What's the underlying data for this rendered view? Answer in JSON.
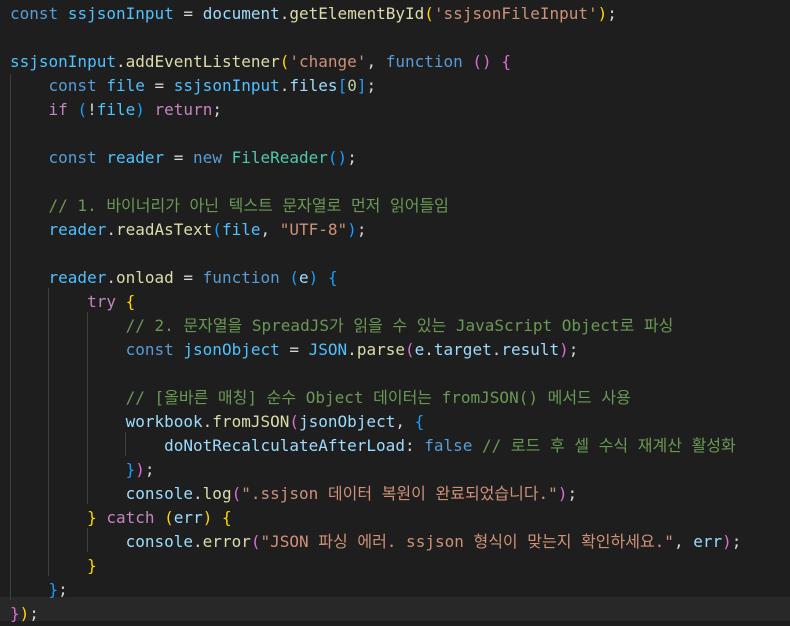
{
  "editor": {
    "lines": [
      [
        [
          "kw",
          "const"
        ],
        [
          "pl",
          " "
        ],
        [
          "cst",
          "ssjsonInput"
        ],
        [
          "pl",
          " = "
        ],
        [
          "var",
          "document"
        ],
        [
          "pl",
          "."
        ],
        [
          "fn",
          "getElementById"
        ],
        [
          "b1",
          "("
        ],
        [
          "str",
          "'ssjsonFileInput'"
        ],
        [
          "b1",
          ")"
        ],
        [
          "pl",
          ";"
        ]
      ],
      [],
      [
        [
          "cst",
          "ssjsonInput"
        ],
        [
          "pl",
          "."
        ],
        [
          "fn",
          "addEventListener"
        ],
        [
          "b1",
          "("
        ],
        [
          "str",
          "'change'"
        ],
        [
          "pl",
          ", "
        ],
        [
          "kw",
          "function"
        ],
        [
          "pl",
          " "
        ],
        [
          "b2",
          "()"
        ],
        [
          "pl",
          " "
        ],
        [
          "b2",
          "{"
        ]
      ],
      [
        [
          "pl",
          "    "
        ],
        [
          "kw",
          "const"
        ],
        [
          "pl",
          " "
        ],
        [
          "cst",
          "file"
        ],
        [
          "pl",
          " = "
        ],
        [
          "cst",
          "ssjsonInput"
        ],
        [
          "pl",
          "."
        ],
        [
          "var",
          "files"
        ],
        [
          "b3",
          "["
        ],
        [
          "num",
          "0"
        ],
        [
          "b3",
          "]"
        ],
        [
          "pl",
          ";"
        ]
      ],
      [
        [
          "pl",
          "    "
        ],
        [
          "ctl",
          "if"
        ],
        [
          "pl",
          " "
        ],
        [
          "b3",
          "("
        ],
        [
          "pl",
          "!"
        ],
        [
          "cst",
          "file"
        ],
        [
          "b3",
          ")"
        ],
        [
          "pl",
          " "
        ],
        [
          "ctl",
          "return"
        ],
        [
          "pl",
          ";"
        ]
      ],
      [],
      [
        [
          "pl",
          "    "
        ],
        [
          "kw",
          "const"
        ],
        [
          "pl",
          " "
        ],
        [
          "cst",
          "reader"
        ],
        [
          "pl",
          " = "
        ],
        [
          "kw",
          "new"
        ],
        [
          "pl",
          " "
        ],
        [
          "cls",
          "FileReader"
        ],
        [
          "b3",
          "()"
        ],
        [
          "pl",
          ";"
        ]
      ],
      [],
      [
        [
          "pl",
          "    "
        ],
        [
          "cmt",
          "// 1. 바이너리가 아닌 텍스트 문자열로 먼저 읽어들임"
        ]
      ],
      [
        [
          "pl",
          "    "
        ],
        [
          "cst",
          "reader"
        ],
        [
          "pl",
          "."
        ],
        [
          "fn",
          "readAsText"
        ],
        [
          "b3",
          "("
        ],
        [
          "cst",
          "file"
        ],
        [
          "pl",
          ", "
        ],
        [
          "str",
          "\"UTF-8\""
        ],
        [
          "b3",
          ")"
        ],
        [
          "pl",
          ";"
        ]
      ],
      [],
      [
        [
          "pl",
          "    "
        ],
        [
          "cst",
          "reader"
        ],
        [
          "pl",
          "."
        ],
        [
          "fn",
          "onload"
        ],
        [
          "pl",
          " = "
        ],
        [
          "kw",
          "function"
        ],
        [
          "pl",
          " "
        ],
        [
          "b3",
          "("
        ],
        [
          "var",
          "e"
        ],
        [
          "b3",
          ")"
        ],
        [
          "pl",
          " "
        ],
        [
          "b3",
          "{"
        ]
      ],
      [
        [
          "pl",
          "        "
        ],
        [
          "ctl",
          "try"
        ],
        [
          "pl",
          " "
        ],
        [
          "b1",
          "{"
        ]
      ],
      [
        [
          "pl",
          "            "
        ],
        [
          "cmt",
          "// 2. 문자열을 SpreadJS가 읽을 수 있는 JavaScript Object로 파싱"
        ]
      ],
      [
        [
          "pl",
          "            "
        ],
        [
          "kw",
          "const"
        ],
        [
          "pl",
          " "
        ],
        [
          "cst",
          "jsonObject"
        ],
        [
          "pl",
          " = "
        ],
        [
          "cst",
          "JSON"
        ],
        [
          "pl",
          "."
        ],
        [
          "fn",
          "parse"
        ],
        [
          "b2",
          "("
        ],
        [
          "var",
          "e"
        ],
        [
          "pl",
          "."
        ],
        [
          "var",
          "target"
        ],
        [
          "pl",
          "."
        ],
        [
          "var",
          "result"
        ],
        [
          "b2",
          ")"
        ],
        [
          "pl",
          ";"
        ]
      ],
      [],
      [
        [
          "pl",
          "            "
        ],
        [
          "cmt",
          "// [올바른 매칭] 순수 Object 데이터는 fromJSON() 메서드 사용"
        ]
      ],
      [
        [
          "pl",
          "            "
        ],
        [
          "var",
          "workbook"
        ],
        [
          "pl",
          "."
        ],
        [
          "fn",
          "fromJSON"
        ],
        [
          "b2",
          "("
        ],
        [
          "var",
          "jsonObject"
        ],
        [
          "pl",
          ", "
        ],
        [
          "b3",
          "{"
        ]
      ],
      [
        [
          "pl",
          "                "
        ],
        [
          "var",
          "doNotRecalculateAfterLoad"
        ],
        [
          "pl",
          ": "
        ],
        [
          "kw",
          "false"
        ],
        [
          "pl",
          " "
        ],
        [
          "cmt",
          "// 로드 후 셀 수식 재계산 활성화"
        ]
      ],
      [
        [
          "pl",
          "            "
        ],
        [
          "b3",
          "}"
        ],
        [
          "b2",
          ")"
        ],
        [
          "pl",
          ";"
        ]
      ],
      [
        [
          "pl",
          "            "
        ],
        [
          "var",
          "console"
        ],
        [
          "pl",
          "."
        ],
        [
          "fn",
          "log"
        ],
        [
          "b2",
          "("
        ],
        [
          "str",
          "\".ssjson 데이터 복원이 완료되었습니다.\""
        ],
        [
          "b2",
          ")"
        ],
        [
          "pl",
          ";"
        ]
      ],
      [
        [
          "pl",
          "        "
        ],
        [
          "b1",
          "}"
        ],
        [
          "pl",
          " "
        ],
        [
          "ctl",
          "catch"
        ],
        [
          "pl",
          " "
        ],
        [
          "b1",
          "("
        ],
        [
          "var",
          "err"
        ],
        [
          "b1",
          ")"
        ],
        [
          "pl",
          " "
        ],
        [
          "b1",
          "{"
        ]
      ],
      [
        [
          "pl",
          "            "
        ],
        [
          "var",
          "console"
        ],
        [
          "pl",
          "."
        ],
        [
          "fn",
          "error"
        ],
        [
          "b2",
          "("
        ],
        [
          "str",
          "\"JSON 파싱 에러. ssjson 형식이 맞는지 확인하세요.\""
        ],
        [
          "pl",
          ", "
        ],
        [
          "var",
          "err"
        ],
        [
          "b2",
          ")"
        ],
        [
          "pl",
          ";"
        ]
      ],
      [
        [
          "pl",
          "        "
        ],
        [
          "b1",
          "}"
        ]
      ],
      [
        [
          "pl",
          "    "
        ],
        [
          "b3",
          "}"
        ],
        [
          "pl",
          ";"
        ]
      ],
      [
        [
          "b2",
          "}"
        ],
        [
          "b1",
          ")"
        ],
        [
          "pl",
          ";"
        ]
      ]
    ]
  }
}
